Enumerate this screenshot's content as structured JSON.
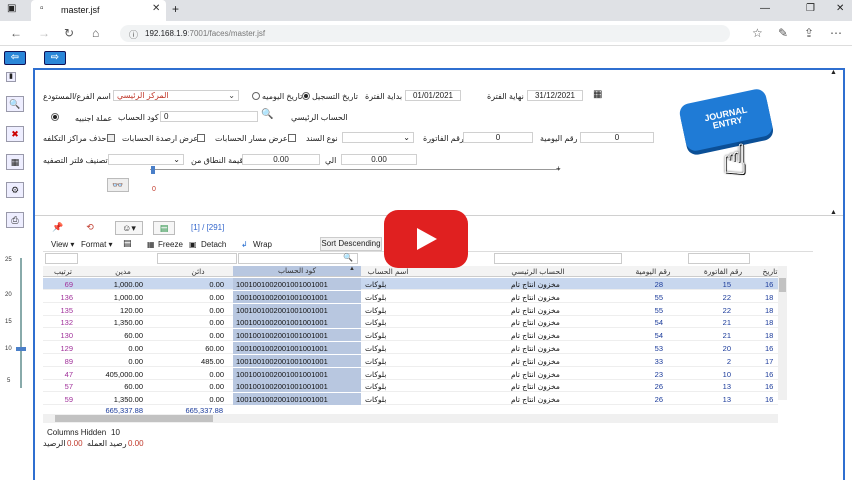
{
  "browser": {
    "tab_title": "master.jsf",
    "url_host": "192.168.1.9",
    "url_path": ":7001/faces/master.jsf",
    "new_tab": "+"
  },
  "form": {
    "branch_label": "اسم الفرع/المستودع",
    "branch_value": "المركز الرئيسي",
    "date_mode_posting": "تاريخ التسجيل",
    "date_mode_daily": "تاريخ اليوميه",
    "period_start_label": "بداية الفترة",
    "period_start": "01/01/2021",
    "period_end_label": "نهاية الفترة",
    "period_end": "31/12/2021",
    "account_code_label": "كود الحساب",
    "account_code_value": "0",
    "main_account_label": "الحساب الرئيسي",
    "foreign_currency_label": "عملة اجنبيه",
    "daily_no_label": "رقم اليومية",
    "daily_no_value": "0",
    "invoice_no_label": "رقم الفاتورة",
    "invoice_no_value": "0",
    "voucher_type_label": "نوع السند",
    "show_account_path_label": "عرض مسار الحسابات",
    "show_balances_label": "عرض ارصدة الحسابات",
    "delete_cost_centers_label": "حذف مراكز التكلفه",
    "filter_class_label": "تصنيف فلتر التصفيه",
    "range_from_label": "قيمة النطاق من",
    "range_from_value": "0.00",
    "range_to_label": "الي",
    "range_to_value": "0.00",
    "slider_value": "0"
  },
  "image": {
    "text": "JOURNAL ENTRY"
  },
  "grid": {
    "pager": "[1] / [291]",
    "menu": {
      "view": "View ▾",
      "format": "Format ▾",
      "freeze": "Freeze",
      "detach": "Detach",
      "wrap": "Wrap"
    },
    "tooltip": "Sort Descending",
    "columns": [
      "ترتيب",
      "مدين",
      "دائن",
      "كود الحساب",
      "اسم الحساب",
      "الحساب الرئيسي",
      "رقم اليومية",
      "رقم الفاتورة",
      "تاريخ"
    ],
    "rows": [
      {
        "order": "69",
        "debit": "1,000.00",
        "credit": "0.00",
        "code": "100100100200100100100​1",
        "name": "بلوكات",
        "main": "مخزون انتاج تام",
        "daily": "28",
        "invoice": "15",
        "date": "16"
      },
      {
        "order": "136",
        "debit": "1,000.00",
        "credit": "0.00",
        "code": "1001001002001001001001",
        "name": "بلوكات",
        "main": "مخزون انتاج تام",
        "daily": "55",
        "invoice": "22",
        "date": "18"
      },
      {
        "order": "135",
        "debit": "120.00",
        "credit": "0.00",
        "code": "1001001002001001001001",
        "name": "بلوكات",
        "main": "مخزون انتاج تام",
        "daily": "55",
        "invoice": "22",
        "date": "18"
      },
      {
        "order": "132",
        "debit": "1,350.00",
        "credit": "0.00",
        "code": "1001001002001001001001",
        "name": "بلوكات",
        "main": "مخزون انتاج تام",
        "daily": "54",
        "invoice": "21",
        "date": "18"
      },
      {
        "order": "130",
        "debit": "60.00",
        "credit": "0.00",
        "code": "1001001002001001001001",
        "name": "بلوكات",
        "main": "مخزون انتاج تام",
        "daily": "54",
        "invoice": "21",
        "date": "18"
      },
      {
        "order": "129",
        "debit": "0.00",
        "credit": "60.00",
        "code": "1001001002001001001001",
        "name": "بلوكات",
        "main": "مخزون انتاج تام",
        "daily": "53",
        "invoice": "20",
        "date": "16"
      },
      {
        "order": "89",
        "debit": "0.00",
        "credit": "485.00",
        "code": "1001001002001001001001",
        "name": "بلوكات",
        "main": "مخزون انتاج تام",
        "daily": "33",
        "invoice": "2",
        "date": "17"
      },
      {
        "order": "47",
        "debit": "405,000.00",
        "credit": "0.00",
        "code": "1001001002001001001001",
        "name": "بلوكات",
        "main": "مخزون انتاج تام",
        "daily": "23",
        "invoice": "10",
        "date": "16"
      },
      {
        "order": "57",
        "debit": "60.00",
        "credit": "0.00",
        "code": "1001001002001001001001",
        "name": "بلوكات",
        "main": "مخزون انتاج تام",
        "daily": "26",
        "invoice": "13",
        "date": "16"
      },
      {
        "order": "59",
        "debit": "1,350.00",
        "credit": "0.00",
        "code": "1001001002001001001001",
        "name": "بلوكات",
        "main": "مخزون انتاج تام",
        "daily": "26",
        "invoice": "13",
        "date": "16"
      }
    ],
    "total_debit": "665,337.88",
    "total_credit": "665,337.88",
    "columns_hidden_label": "Columns Hidden",
    "columns_hidden_value": "10",
    "balance_label": "الرصيد",
    "balance_value": "0.00",
    "currency_balance_label": "رصيد العمله",
    "currency_balance_value": "0.00"
  },
  "vslider": {
    "ticks": [
      "25",
      "20",
      "15",
      "10",
      "5"
    ]
  }
}
